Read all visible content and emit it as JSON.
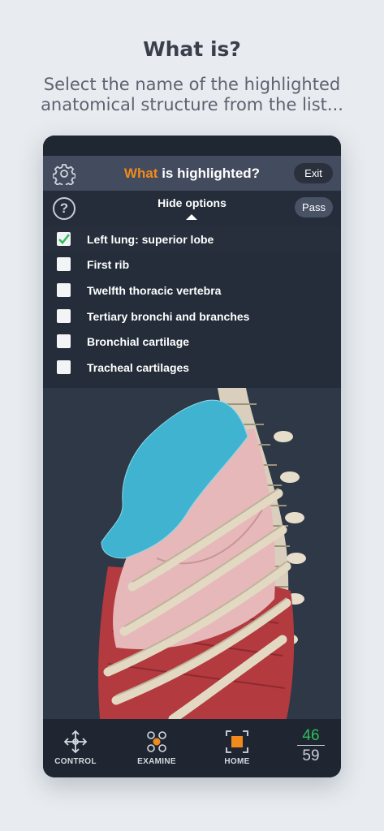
{
  "header": {
    "title": "What is?",
    "subtitle": "Select the name of the highlighted anatomical structure from the list..."
  },
  "app": {
    "title_accent": "What",
    "title_rest": " is highlighted?",
    "exit_label": "Exit",
    "hide_options_label": "Hide options",
    "pass_label": "Pass",
    "help_symbol": "?"
  },
  "options": [
    {
      "label": "Left lung: superior lobe",
      "checked": true
    },
    {
      "label": "First rib",
      "checked": false
    },
    {
      "label": "Twelfth thoracic vertebra",
      "checked": false
    },
    {
      "label": "Tertiary bronchi and branches",
      "checked": false
    },
    {
      "label": "Bronchial cartilage",
      "checked": false
    },
    {
      "label": "Tracheal cartilages",
      "checked": false
    }
  ],
  "nav": {
    "control_label": "CONTROL",
    "examine_label": "EXAMINE",
    "home_label": "HOME"
  },
  "score": {
    "correct": "46",
    "total": "59"
  },
  "colors": {
    "accent": "#f08a1c",
    "highlight": "#3fb3d0",
    "check": "#2fbf5a",
    "panel": "#434b5e"
  }
}
